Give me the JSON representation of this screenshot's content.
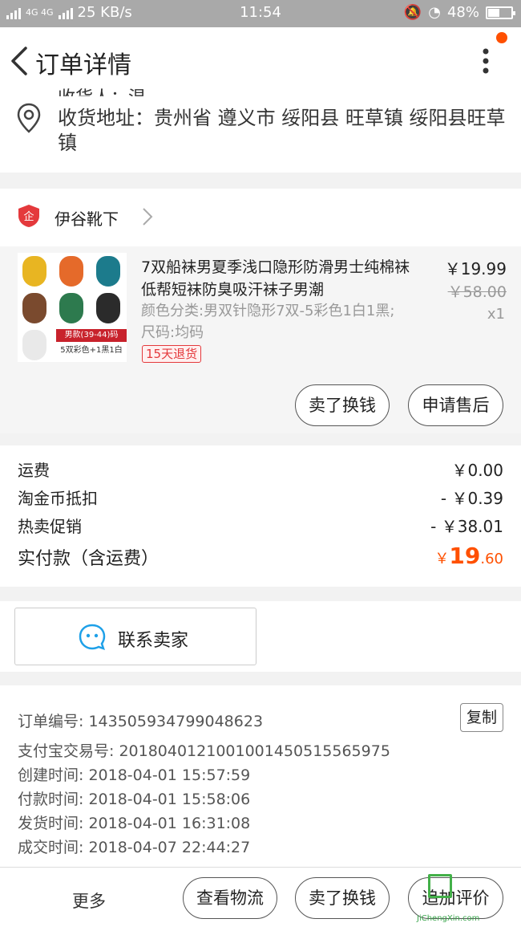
{
  "status_bar": {
    "network": "4G 4G",
    "speed": "25 KB/s",
    "time": "11:54",
    "battery": "48%",
    "battery_level": 0.48
  },
  "nav": {
    "title": "订单详情",
    "back_icon": "chevron-left-icon",
    "more_icon": "more-vertical-icon",
    "badge_color": "#ff5000"
  },
  "address": {
    "text": "收货地址：贵州省 遵义市 绥阳县 旺草镇 绥阳县旺草镇",
    "partial_top": "收货人：温..."
  },
  "shop": {
    "name": "伊谷靴下",
    "item": {
      "title": "7双船袜男夏季浅口隐形防滑男士纯棉袜低帮短袜防臭吸汗袜子男潮",
      "sku": "颜色分类:男双针隐形7双-5彩色1白1黑;尺码:均码",
      "badge": "15天退货",
      "price": "￥19.99",
      "original_price": "￥58.00",
      "qty": "x1",
      "thumb_tag": "男款(39-44)码",
      "thumb_tag2": "5双彩色+1黑1白"
    },
    "buttons": {
      "sell": "卖了换钱",
      "after_sale": "申请售后"
    }
  },
  "fees": {
    "shipping_label": "运费",
    "shipping_value": "￥0.00",
    "coin_label": "淘金币抵扣",
    "coin_value": "- ￥0.39",
    "promo_label": "热卖促销",
    "promo_value": "- ￥38.01",
    "total_label": "实付款（含运费）",
    "total_currency": "￥",
    "total_int": "19",
    "total_dec": ".60",
    "accent_color": "#ff5000"
  },
  "contact": {
    "label": "联系卖家"
  },
  "info": {
    "order_no": "订单编号: 143505934799048623",
    "alipay_no": "支付宝交易号: 2018040121001001450515565975",
    "created": "创建时间: 2018-04-01 15:57:59",
    "paid": "付款时间: 2018-04-01 15:58:06",
    "shipped": "发货时间: 2018-04-01 16:31:08",
    "done": "成交时间: 2018-04-07 22:44:27",
    "copy": "复制"
  },
  "bottom": {
    "more": "更多",
    "logistics": "查看物流",
    "sell": "卖了换钱",
    "review": "追加评价",
    "watermark": "JiChengXin.com"
  }
}
